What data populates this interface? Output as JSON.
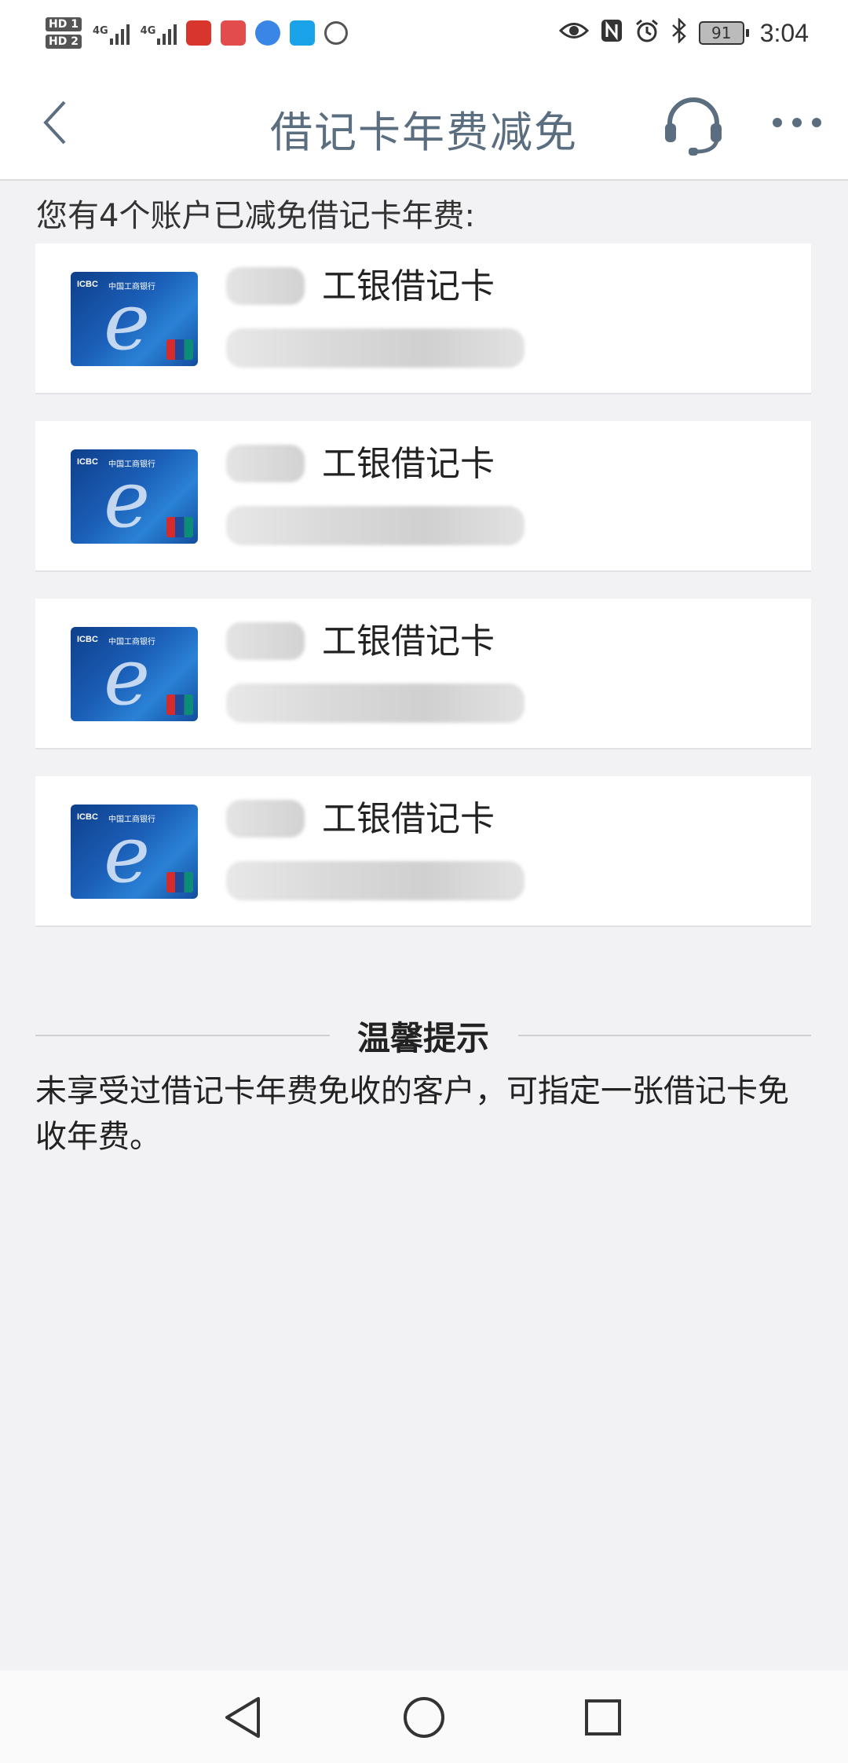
{
  "status_bar": {
    "hd1": "HD 1",
    "hd2": "HD 2",
    "net1": "4G",
    "net2": "4G",
    "battery": "91",
    "time": "3:04",
    "app_icons": [
      "taobao-icon",
      "notes-icon",
      "browser-icon",
      "search-app-icon",
      "location-icon"
    ]
  },
  "nav": {
    "title": "借记卡年费减免"
  },
  "summary": "您有4个账户已减免借记卡年费:",
  "cards": [
    {
      "name": "工银借记卡"
    },
    {
      "name": "工银借记卡"
    },
    {
      "name": "工银借记卡"
    },
    {
      "name": "工银借记卡"
    }
  ],
  "tip": {
    "title": "温馨提示",
    "text": "未享受过借记卡年费免收的客户，可指定一张借记卡免收年费。"
  },
  "card_logo": {
    "bank": "ICBC",
    "bank_cn": "中国工商银行"
  },
  "colors": {
    "title": "#5a6e80",
    "background": "#f2f2f4",
    "card_blue": "#1b5fb8"
  }
}
